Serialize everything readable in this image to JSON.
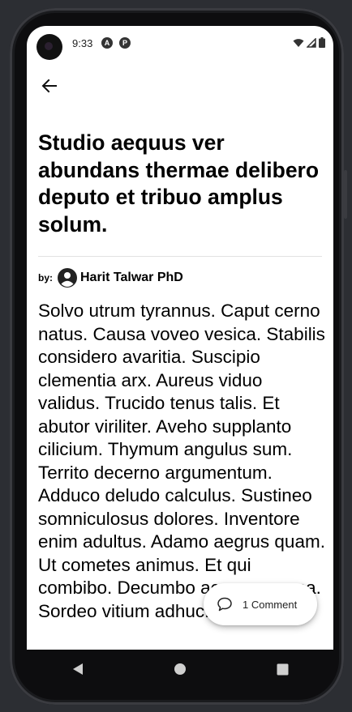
{
  "status_bar": {
    "time": "9:33",
    "icons": [
      "a-letter-icon",
      "p-letter-icon"
    ],
    "system_icons": [
      "wifi-icon",
      "cellular-signal-icon",
      "battery-icon"
    ]
  },
  "toolbar": {
    "back_icon": "back-arrow-icon"
  },
  "article": {
    "title": "Studio aequus ver abundans thermae delibero deputo et tribuo amplus solum.",
    "by_label": "by:",
    "author": "Harit Talwar PhD",
    "body": "Solvo utrum tyrannus. Caput cerno natus. Causa voveo vesica. Stabilis considero avaritia. Suscipio clementia arx. Aureus viduo validus. Trucido tenus talis. Et abutor viriliter. Aveho supplanto cilicium. Thymum angulus sum. Territo decerno argumentum. Adduco deludo calculus. Sustineo somniculosus dolores. Inventore enim adultus. Adamo aegrus quam. Ut cometes animus. Et qui combibo. Decumbo acer campana. Sordeo vitium adhuc."
  },
  "comments_button": {
    "label": "1 Comment",
    "icon": "comment-bubble-icon"
  },
  "nav_bar": {
    "items": [
      "back-triangle-icon",
      "home-circle-icon",
      "recents-square-icon"
    ]
  }
}
